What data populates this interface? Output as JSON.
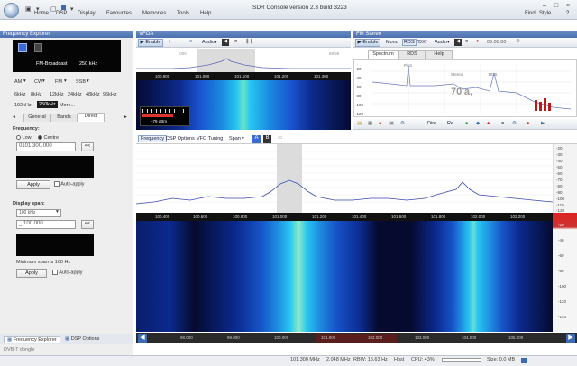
{
  "app": {
    "title": "SDR Console version 2.3 build 3223",
    "menus": [
      "Home",
      "DSP",
      "Display",
      "Favourites",
      "Memories",
      "Tools",
      "Help"
    ],
    "right_controls": [
      "Find",
      "Style",
      "?"
    ]
  },
  "left": {
    "title": "Frequency Explorer",
    "display": {
      "mode": "FM-Broadcast",
      "bw": "250 kHz"
    },
    "modes": [
      "AM",
      "CW",
      "FM",
      "SSB"
    ],
    "bandwidths_row1": [
      "6kHz",
      "8kHz",
      "12kHz",
      "24kHz",
      "48kHz",
      "96kHz"
    ],
    "bandwidths_row2": [
      "192kHz",
      "250kHz",
      "More..."
    ],
    "tabs": [
      "General",
      "Bands",
      "Direct"
    ],
    "frequency_label": "Frequency:",
    "radio_low": "Low",
    "radio_centre": "Centre",
    "freq_value": "0101.300.000",
    "back_btn": "<<",
    "apply": "Apply",
    "auto_apply": "Auto-apply",
    "span_label": "Display span:",
    "span_select": "100 kHz",
    "span_value": "_.100.000",
    "min_span": "Minimum span is 100 Hz",
    "bottom_tabs": [
      "Frequency Explorer",
      "DSP Options"
    ],
    "device": "DVB-T dongle"
  },
  "vfoa": {
    "title": "VFOA",
    "enable": "Enable",
    "audio": "Audio",
    "ticks": [
      "100.900",
      "101.000",
      "101.100",
      "101.200",
      "101.300"
    ],
    "level_top": ".000",
    "level_right": "88 99",
    "dbm": "-79 dBm"
  },
  "stereo": {
    "title": "FM Stereo",
    "enable": "Enable",
    "mono": "Mono",
    "rds": "RDS",
    "dx": "*DX*",
    "audio": "Audio",
    "time": "00:00:00",
    "tabs": [
      "Spectrum",
      "RDS",
      "Help"
    ],
    "big": "70'a,",
    "yaxis": [
      "-20",
      "-40",
      "-60",
      "-80",
      "-100",
      "-120"
    ],
    "labels": [
      "Pilot",
      "Stereo",
      "RDS"
    ],
    "tools": [
      "Dire",
      "Re"
    ]
  },
  "main": {
    "tabs": [
      "Frequency",
      "DSP Options",
      "VFO Tuning",
      "Span"
    ],
    "ticks": [
      "100.400",
      "100.600",
      "100.800",
      "101.000",
      "101.200",
      "101.400",
      "101.600",
      "101.800",
      "102.000",
      "102.200"
    ],
    "right_axis": [
      "-20",
      "-40",
      "-60",
      "-80",
      "-100",
      "-120",
      "-140"
    ],
    "top_axis": [
      "-20",
      "-30",
      "-40",
      "-50",
      "-60",
      "-70",
      "-80",
      "-90",
      "-100",
      "-110",
      "-120"
    ],
    "bottom_ticks": [
      "98.000",
      "99.000",
      "100.000",
      "101.000",
      "102.000",
      "103.000",
      "104.000",
      "105.000"
    ]
  },
  "status": {
    "freq": "101.300 MHz",
    "rate": "2.048 MHz",
    "rbw": "RBW: 15.63 Hz",
    "mode": "Host",
    "cpu": "CPU: 43%",
    "size": "Size: 0.0 MB"
  },
  "colors": {
    "accent": "#4b70ad",
    "waterfall_signal": "#27c7f0",
    "waterfall_bg": "#0a1d6b"
  }
}
